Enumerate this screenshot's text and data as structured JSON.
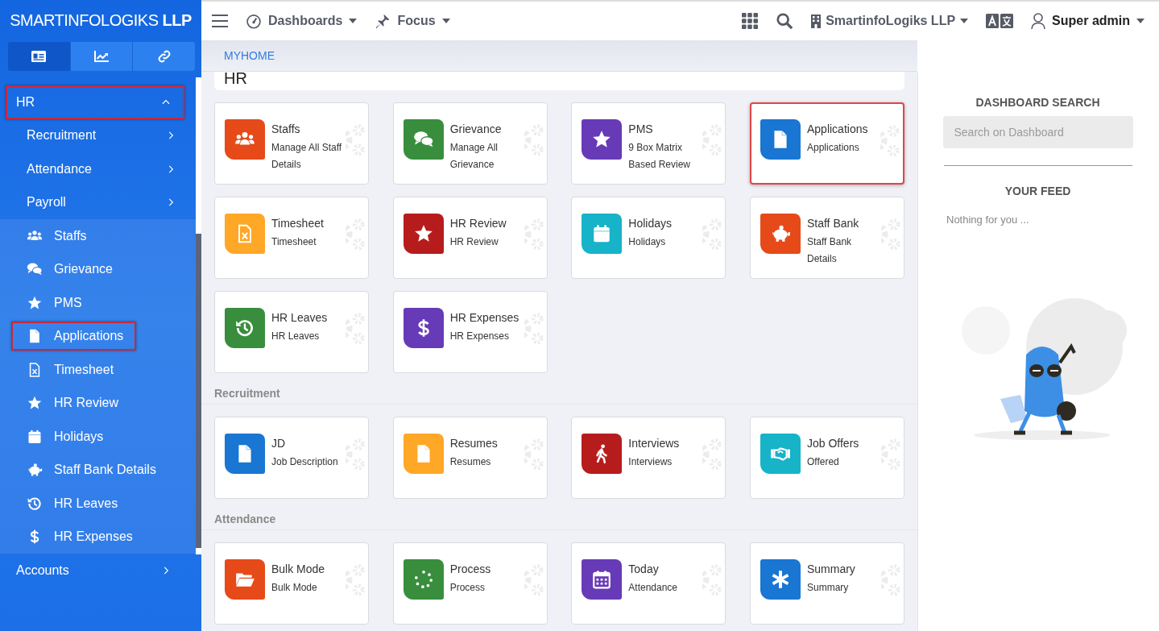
{
  "sidebar": {
    "brand": "SMARTINFOLOGIKS **LLP**",
    "tabs": [
      {
        "selected": true
      },
      {
        "selected": false
      },
      {
        "selected": false
      }
    ],
    "menu": [
      {
        "label": "HR",
        "expanded": true,
        "highlighted": true,
        "children": [
          {
            "label": "Recruitment",
            "kind": "group",
            "expanded": false,
            "highlighted": false
          },
          {
            "label": "Attendance",
            "kind": "group",
            "expanded": false,
            "highlighted": false
          },
          {
            "label": "Payroll",
            "kind": "group",
            "expanded": false,
            "highlighted": false
          },
          {
            "label": "Staffs",
            "kind": "link",
            "highlighted": false
          },
          {
            "label": "Grievance",
            "kind": "link",
            "highlighted": false
          },
          {
            "label": "PMS",
            "kind": "link",
            "highlighted": false
          },
          {
            "label": "Applications",
            "kind": "link",
            "highlighted": true
          },
          {
            "label": "Timesheet",
            "kind": "link",
            "highlighted": false
          },
          {
            "label": "HR Review",
            "kind": "link",
            "highlighted": false
          },
          {
            "label": "Holidays",
            "kind": "link",
            "highlighted": false
          },
          {
            "label": "Staff Bank Details",
            "kind": "link",
            "highlighted": false
          },
          {
            "label": "HR Leaves",
            "kind": "link",
            "highlighted": false
          },
          {
            "label": "HR Expenses",
            "kind": "link",
            "highlighted": false
          }
        ]
      },
      {
        "label": "Accounts",
        "expanded": false,
        "highlighted": false
      }
    ]
  },
  "topbar": {
    "menus": [
      {
        "label": "Dashboards"
      },
      {
        "label": "Focus"
      }
    ],
    "company": "SmartinfoLogiks LLP",
    "user": "Super admin"
  },
  "breadcrumb": "MYHOME",
  "sections": [
    {
      "title": "HR",
      "kind": "banner",
      "cards": [
        {
          "title": "Staffs",
          "subtitle": "Manage All Staff Details",
          "color": "#e64a19",
          "highlighted": false
        },
        {
          "title": "Grievance",
          "subtitle": "Manage All Grievance",
          "color": "#388e3c",
          "highlighted": false
        },
        {
          "title": "PMS",
          "subtitle": "9 Box Matrix Based Review",
          "color": "#673ab7",
          "highlighted": false
        },
        {
          "title": "Applications",
          "subtitle": "Applications",
          "color": "#1976d2",
          "highlighted": true
        },
        {
          "title": "Timesheet",
          "subtitle": "Timesheet",
          "color": "#ffa726",
          "highlighted": false
        },
        {
          "title": "HR Review",
          "subtitle": "HR Review",
          "color": "#b71c1c",
          "highlighted": false
        },
        {
          "title": "Holidays",
          "subtitle": "Holidays",
          "color": "#17b3c8",
          "highlighted": false
        },
        {
          "title": "Staff Bank",
          "subtitle": "Staff Bank Details",
          "color": "#e64a19",
          "highlighted": false
        },
        {
          "title": "HR Leaves",
          "subtitle": "HR Leaves",
          "color": "#388e3c",
          "highlighted": false
        },
        {
          "title": "HR Expenses",
          "subtitle": "HR Expenses",
          "color": "#673ab7",
          "highlighted": false
        }
      ]
    },
    {
      "title": "Recruitment",
      "kind": "heading",
      "cards": [
        {
          "title": "JD",
          "subtitle": "Job Description",
          "color": "#1976d2",
          "highlighted": false
        },
        {
          "title": "Resumes",
          "subtitle": "Resumes",
          "color": "#ffa726",
          "highlighted": false
        },
        {
          "title": "Interviews",
          "subtitle": "Interviews",
          "color": "#b71c1c",
          "highlighted": false
        },
        {
          "title": "Job Offers",
          "subtitle": "Offered",
          "color": "#17b3c8",
          "highlighted": false
        }
      ]
    },
    {
      "title": "Attendance",
      "kind": "heading",
      "cards": [
        {
          "title": "Bulk Mode",
          "subtitle": "Bulk Mode",
          "color": "#e64a19",
          "highlighted": false
        },
        {
          "title": "Process",
          "subtitle": "Process",
          "color": "#388e3c",
          "highlighted": false
        },
        {
          "title": "Today",
          "subtitle": "Attendance",
          "color": "#673ab7",
          "highlighted": false
        },
        {
          "title": "Summary",
          "subtitle": "Summary",
          "color": "#1976d2",
          "highlighted": false
        }
      ]
    }
  ],
  "side_panel": {
    "search_title": "DASHBOARD SEARCH",
    "search_placeholder": "Search on Dashboard",
    "feed_title": "YOUR FEED",
    "feed_empty": "Nothing for you ..."
  }
}
